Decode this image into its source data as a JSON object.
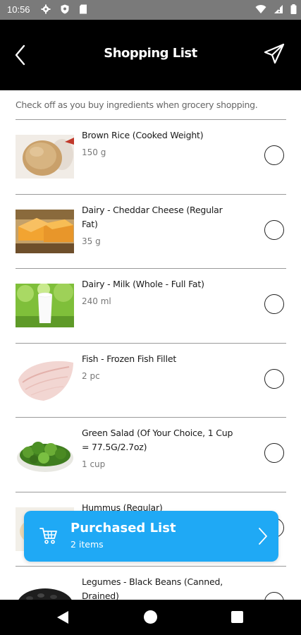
{
  "status_bar": {
    "time": "10:56",
    "left_icons": [
      "settings-icon",
      "shield-icon",
      "sd-card-icon"
    ],
    "right_icons": [
      "wifi-icon",
      "cell-signal-icon",
      "battery-icon"
    ]
  },
  "header": {
    "title": "Shopping List",
    "back_icon": "chevron-left-icon",
    "share_icon": "paper-plane-icon",
    "background": "#000000"
  },
  "instruction": "Check off as you buy ingredients when grocery shopping.",
  "items": [
    {
      "name": "Brown Rice (Cooked Weight)",
      "quantity": "150 g",
      "checked": false
    },
    {
      "name": "Dairy - Cheddar Cheese (Regular Fat)",
      "quantity": "35 g",
      "checked": false
    },
    {
      "name": "Dairy - Milk (Whole - Full Fat)",
      "quantity": "240 ml",
      "checked": false
    },
    {
      "name": "Fish - Frozen Fish Fillet",
      "quantity": "2 pc",
      "checked": false
    },
    {
      "name": "Green Salad (Of Your Choice, 1 Cup = 77.5G/2.7oz)",
      "quantity": "1 cup",
      "checked": false
    },
    {
      "name": "Hummus (Regular)",
      "quantity": "",
      "checked": false
    },
    {
      "name": "Legumes - Black Beans (Canned, Drained)",
      "quantity": "",
      "checked": false
    }
  ],
  "purchased": {
    "title": "Purchased List",
    "count_label": "2 items",
    "icon": "shopping-cart-icon",
    "color": "#1fa9f5"
  },
  "nav_bar": {
    "icons": [
      "back-triangle-icon",
      "home-circle-icon",
      "recents-square-icon"
    ]
  }
}
